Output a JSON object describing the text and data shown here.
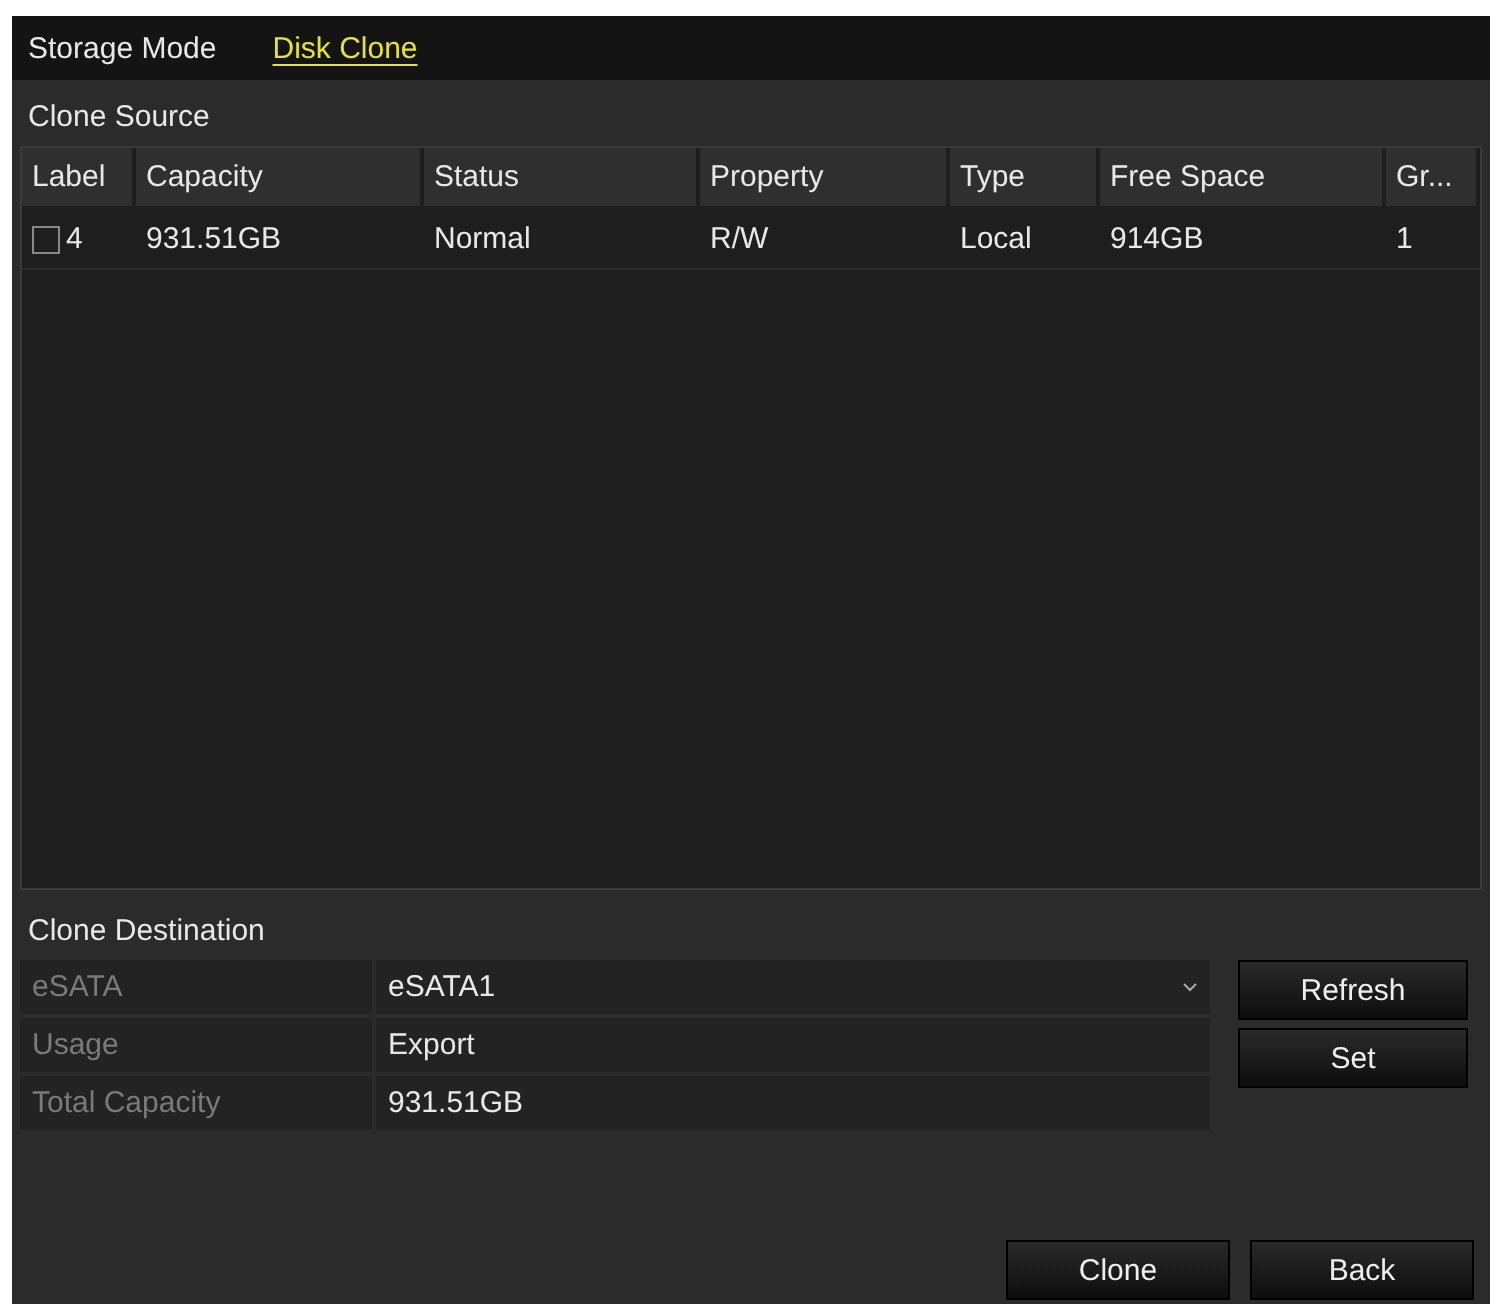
{
  "tabs": [
    {
      "label": "Storage Mode",
      "selected": false
    },
    {
      "label": "Disk Clone",
      "selected": true
    }
  ],
  "clone_source": {
    "title": "Clone Source",
    "table": {
      "columns": [
        "Label",
        "Capacity",
        "Status",
        "Property",
        "Type",
        "Free Space",
        "Gr..."
      ],
      "rows": [
        {
          "checked": false,
          "cells": [
            "4",
            "931.51GB",
            "Normal",
            "R/W",
            "Local",
            "914GB",
            "1"
          ]
        }
      ]
    }
  },
  "clone_destination": {
    "title": "Clone Destination",
    "fields": [
      {
        "label": "eSATA",
        "value": "eSATA1",
        "kind": "dropdown"
      },
      {
        "label": "Usage",
        "value": "Export",
        "kind": "text"
      },
      {
        "label": "Total Capacity",
        "value": "931.51GB",
        "kind": "text"
      }
    ],
    "buttons": [
      "Refresh",
      "Set"
    ]
  },
  "footer_buttons": [
    "Clone",
    "Back"
  ]
}
